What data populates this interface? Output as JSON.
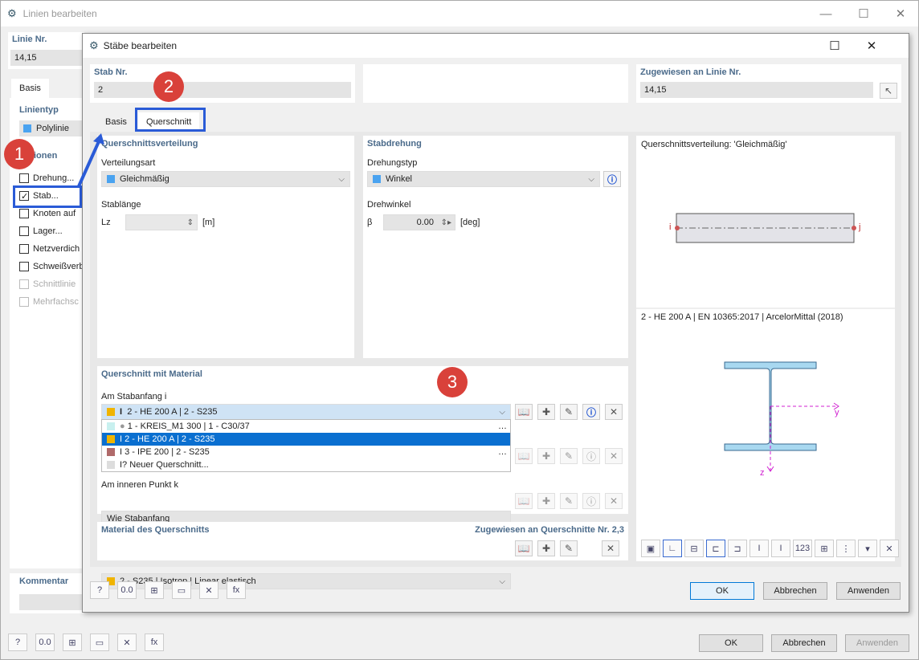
{
  "outer": {
    "title": "Linien bearbeiten",
    "linie_label": "Linie Nr.",
    "linie_value": "14,15",
    "tab_basis": "Basis",
    "linientyp_label": "Linientyp",
    "linientyp_value": "Polylinie",
    "optionen_label": "ionen",
    "options": [
      "Drehung...",
      "Stab...",
      "Knoten auf",
      "Lager...",
      "Netzverdich",
      "Schweißverb",
      "Schnittlinie",
      "Mehrfachsc"
    ],
    "kommentar_label": "Kommentar",
    "ok": "OK",
    "abbrechen": "Abbrechen",
    "anwenden": "Anwenden"
  },
  "inner": {
    "title": "Stäbe bearbeiten",
    "stab_label": "Stab Nr.",
    "stab_value": "2",
    "zugewiesen_label": "Zugewiesen an Linie Nr.",
    "zugewiesen_value": "14,15",
    "tab_basis": "Basis",
    "tab_querschnitt": "Querschnitt",
    "qv": {
      "header": "Querschnittsverteilung",
      "verteilungsart_label": "Verteilungsart",
      "verteilungsart_value": "Gleichmäßig",
      "stablaenge_label": "Stablänge",
      "lz": "Lz",
      "unit": "[m]"
    },
    "sd": {
      "header": "Stabdrehung",
      "typ_label": "Drehungstyp",
      "typ_value": "Winkel",
      "winkel_label": "Drehwinkel",
      "beta": "β",
      "beta_value": "0.00",
      "unit": "[deg]"
    },
    "preview": {
      "top_title": "Querschnittsverteilung: 'Gleichmäßig'",
      "node_i": "i",
      "node_j": "j",
      "section_title": "2 - HE 200 A | EN 10365:2017 | ArcelorMittal (2018)",
      "axis_y": "y",
      "axis_z": "z"
    },
    "qm": {
      "header": "Querschnitt mit Material",
      "anfang_label": "Am Stabanfang i",
      "selected": "2 - HE 200 A | 2 - S235",
      "dropdown": [
        "1 - KREIS_M1 300 | 1 - C30/37",
        "2 - HE 200 A | 2 - S235",
        "3 - IPE 200 | 2 - S235",
        "Neuer Querschnitt..."
      ],
      "inner_label": "Am inneren Punkt k",
      "inner_value": "Wie Stabanfang"
    },
    "mat": {
      "header": "Material des Querschnitts",
      "assigned": "Zugewiesen an Querschnitte Nr. 2,3",
      "value": "2 - S235 | Isotrop | Linear elastisch"
    },
    "ok": "OK",
    "abbrechen": "Abbrechen",
    "anwenden": "Anwenden"
  },
  "annotations": {
    "n1": "1",
    "n2": "2",
    "n3": "3"
  },
  "colors": {
    "accent": "#2a5bd7",
    "badge": "#d9413a",
    "square_blue": "#4aa3f0",
    "square_yellow": "#f0b400",
    "square_brown": "#b06a6a",
    "square_teal": "#c8f0ef",
    "selection": "#0a6fd0"
  }
}
